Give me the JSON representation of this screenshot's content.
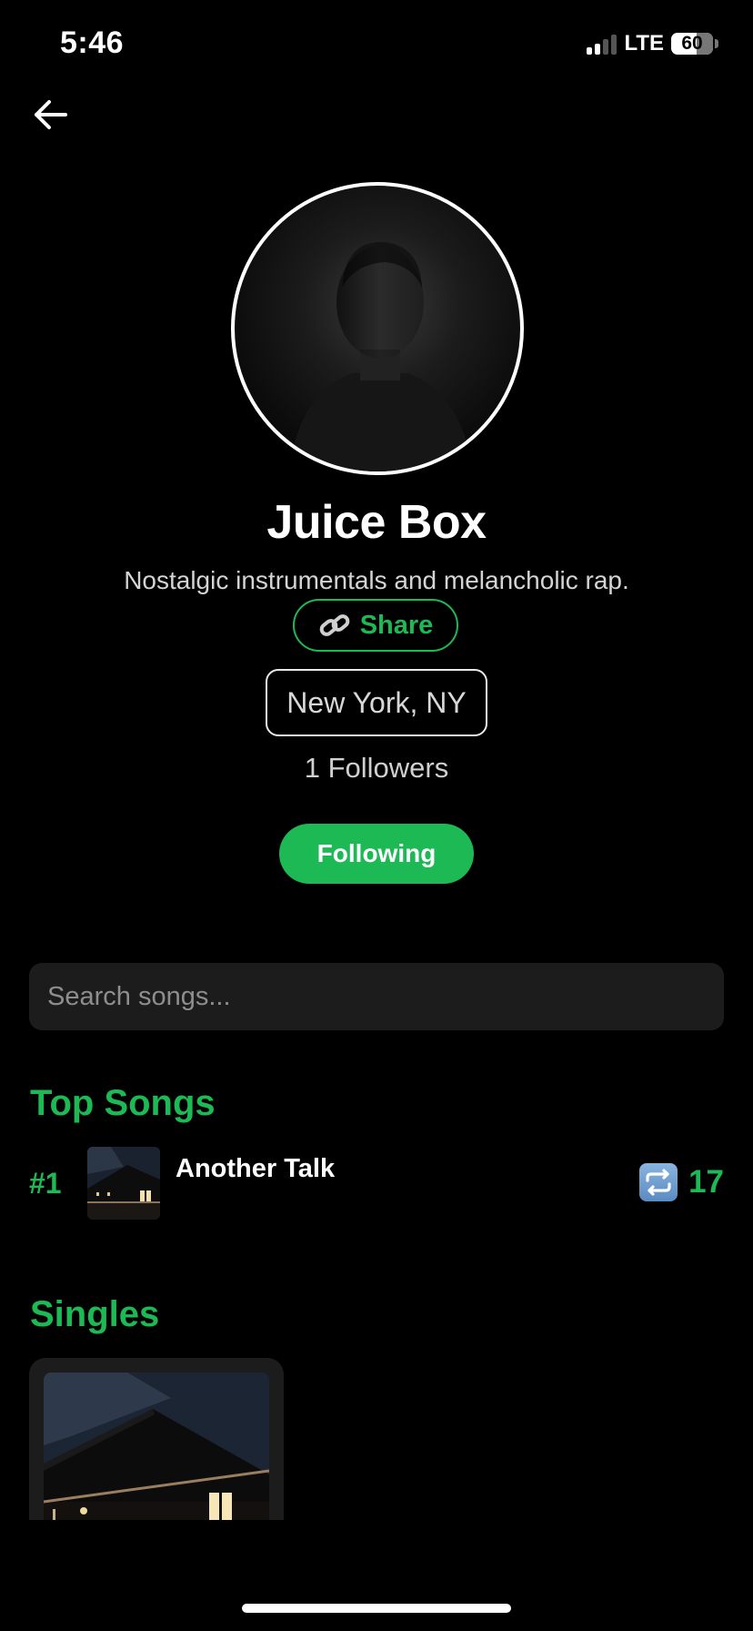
{
  "status_bar": {
    "time": "5:46",
    "network": "LTE",
    "battery": "60",
    "battery_level": 0.6,
    "signal_bars": 2
  },
  "header": {
    "back_icon": "arrow-left-icon"
  },
  "profile": {
    "name": "Juice Box",
    "bio": "Nostalgic instrumentals and melancholic rap.",
    "share_label": "Share",
    "share_icon": "link-icon",
    "location": "New York, NY",
    "followers_text": "1 Followers",
    "follow_button_label": "Following"
  },
  "search": {
    "placeholder": "Search songs..."
  },
  "top_songs": {
    "title": "Top Songs",
    "items": [
      {
        "rank": "#1",
        "title": "Another Talk",
        "repost_icon": "repeat-icon",
        "count": "17"
      }
    ]
  },
  "singles": {
    "title": "Singles"
  },
  "colors": {
    "accent": "#1db954",
    "background": "#000000",
    "surface": "#1c1c1c"
  }
}
